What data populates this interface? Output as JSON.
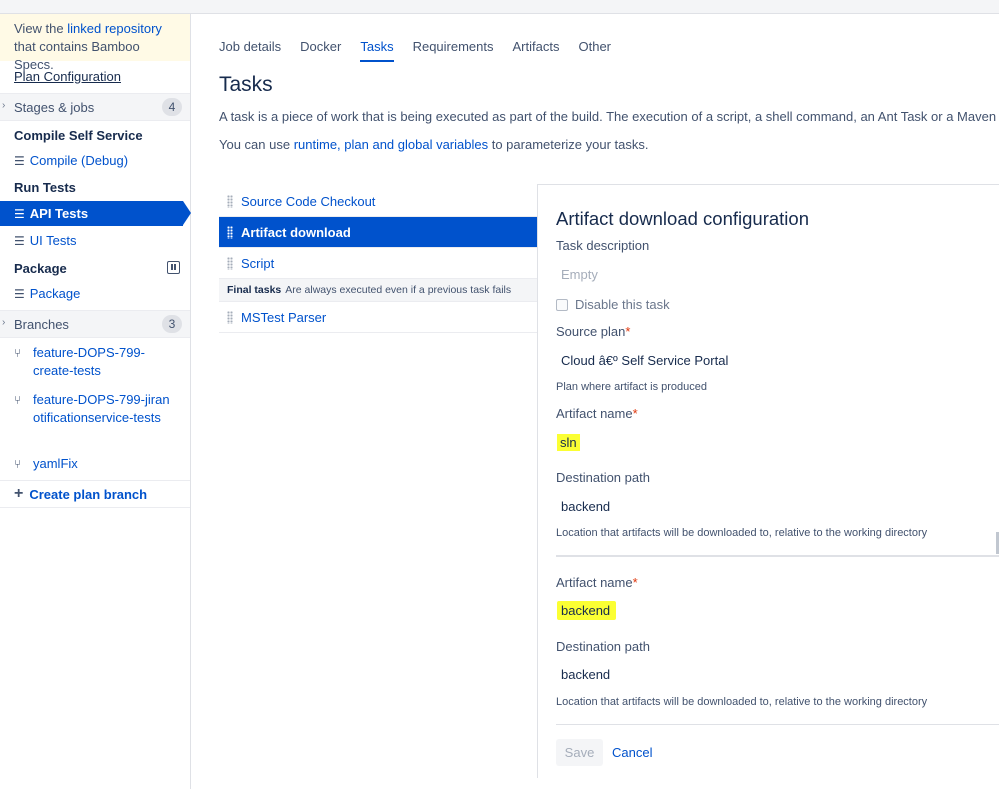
{
  "sidebar": {
    "specs_notice": {
      "prefix": "View the ",
      "link": "linked repository",
      "suffix": "that contains Bamboo Specs."
    },
    "plan_configuration": "Plan Configuration",
    "stages": {
      "label": "Stages & jobs",
      "count": "4"
    },
    "stage_groups": [
      {
        "title": "Compile Self Service",
        "jobs": [
          "Compile (Debug)"
        ]
      },
      {
        "title": "Run Tests",
        "jobs": [
          "API Tests",
          "UI Tests"
        ]
      },
      {
        "title": "Package",
        "jobs": [
          "Package"
        ]
      }
    ],
    "branches": {
      "label": "Branches",
      "count": "3",
      "items": [
        "feature-DOPS-799-create-tests",
        "feature-DOPS-799-jiranotificationservice-tests",
        "yamlFix"
      ]
    },
    "create_branch": "Create plan branch"
  },
  "tabs": [
    "Job details",
    "Docker",
    "Tasks",
    "Requirements",
    "Artifacts",
    "Other"
  ],
  "active_tab": "Tasks",
  "main": {
    "title": "Tasks",
    "intro1": "A task is a piece of work that is being executed as part of the build. The execution of a script, a shell command, an Ant Task or a Maven g",
    "intro2_prefix": "You can use ",
    "intro2_link": "runtime, plan and global variables",
    "intro2_suffix": " to parameterize your tasks."
  },
  "tasks": {
    "items": [
      "Source Code Checkout",
      "Artifact download",
      "Script"
    ],
    "final_label": "Final tasks",
    "final_note": "Are always executed even if a previous task fails",
    "final_items": [
      "MSTest Parser"
    ]
  },
  "config": {
    "title": "Artifact download configuration",
    "task_description_label": "Task description",
    "task_description_placeholder": "Empty",
    "disable_label": "Disable this task",
    "source_plan_label": "Source plan",
    "source_plan_value": "Cloud â€º Self Service Portal",
    "source_plan_hint": "Plan where artifact is produced",
    "required_mark": "*",
    "artifacts": [
      {
        "name_label": "Artifact name",
        "name": "sln",
        "path_label": "Destination path",
        "path": "backend",
        "path_hint": "Location that artifacts will be downloaded to, relative to the working directory"
      },
      {
        "name_label": "Artifact name",
        "name": "backend",
        "path_label": "Destination path",
        "path": "backend",
        "path_hint": "Location that artifacts will be downloaded to, relative to the working directory"
      }
    ],
    "save": "Save",
    "cancel": "Cancel"
  },
  "colors": {
    "accent": "#0052cc",
    "highlight": "#fbff33",
    "notice_bg": "#fffae6"
  }
}
